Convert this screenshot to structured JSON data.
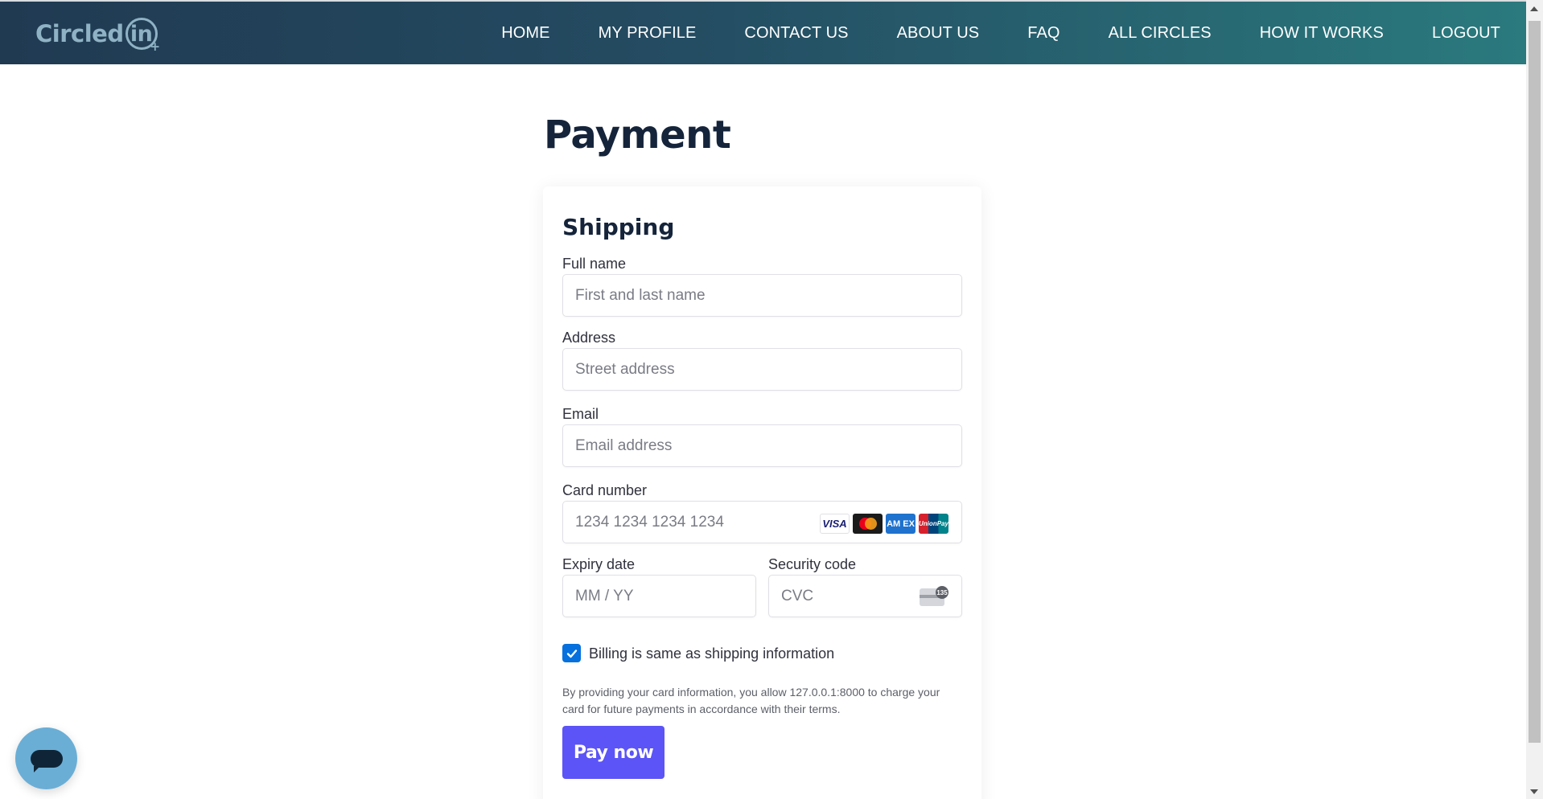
{
  "brand": {
    "name": "Circled",
    "name_suffix": "in",
    "plus": "+"
  },
  "nav": {
    "items": [
      {
        "label": "HOME"
      },
      {
        "label": "MY PROFILE"
      },
      {
        "label": "CONTACT US"
      },
      {
        "label": "ABOUT US"
      },
      {
        "label": "FAQ"
      },
      {
        "label": "ALL CIRCLES"
      },
      {
        "label": "HOW IT WORKS"
      },
      {
        "label": "LOGOUT"
      }
    ]
  },
  "page": {
    "title": "Payment"
  },
  "form": {
    "section_title": "Shipping",
    "full_name": {
      "label": "Full name",
      "placeholder": "First and last name",
      "value": ""
    },
    "address": {
      "label": "Address",
      "placeholder": "Street address",
      "value": ""
    },
    "email": {
      "label": "Email",
      "placeholder": "Email address",
      "value": ""
    },
    "card_number": {
      "label": "Card number",
      "placeholder": "1234 1234 1234 1234",
      "value": ""
    },
    "card_brands": [
      {
        "name": "visa-icon",
        "text": "VISA"
      },
      {
        "name": "mastercard-icon",
        "text": ""
      },
      {
        "name": "amex-icon",
        "text": "AM EX"
      },
      {
        "name": "unionpay-icon",
        "text": "UnionPay"
      }
    ],
    "expiry": {
      "label": "Expiry date",
      "placeholder": "MM / YY",
      "value": ""
    },
    "security_code": {
      "label": "Security code",
      "placeholder": "CVC",
      "value": "",
      "badge": "135"
    },
    "billing_same": {
      "label": "Billing is same as shipping information",
      "checked": true
    },
    "terms": "By providing your card information, you allow 127.0.0.1:8000 to charge your card for future payments in accordance with their terms.",
    "pay_button": "Pay now"
  },
  "colors": {
    "nav_start": "#203a52",
    "nav_end": "#2a7a7e",
    "title": "#15243a",
    "accent_button": "#5c54f6",
    "checkbox": "#0570de",
    "chat_bubble": "#6aaed6"
  }
}
